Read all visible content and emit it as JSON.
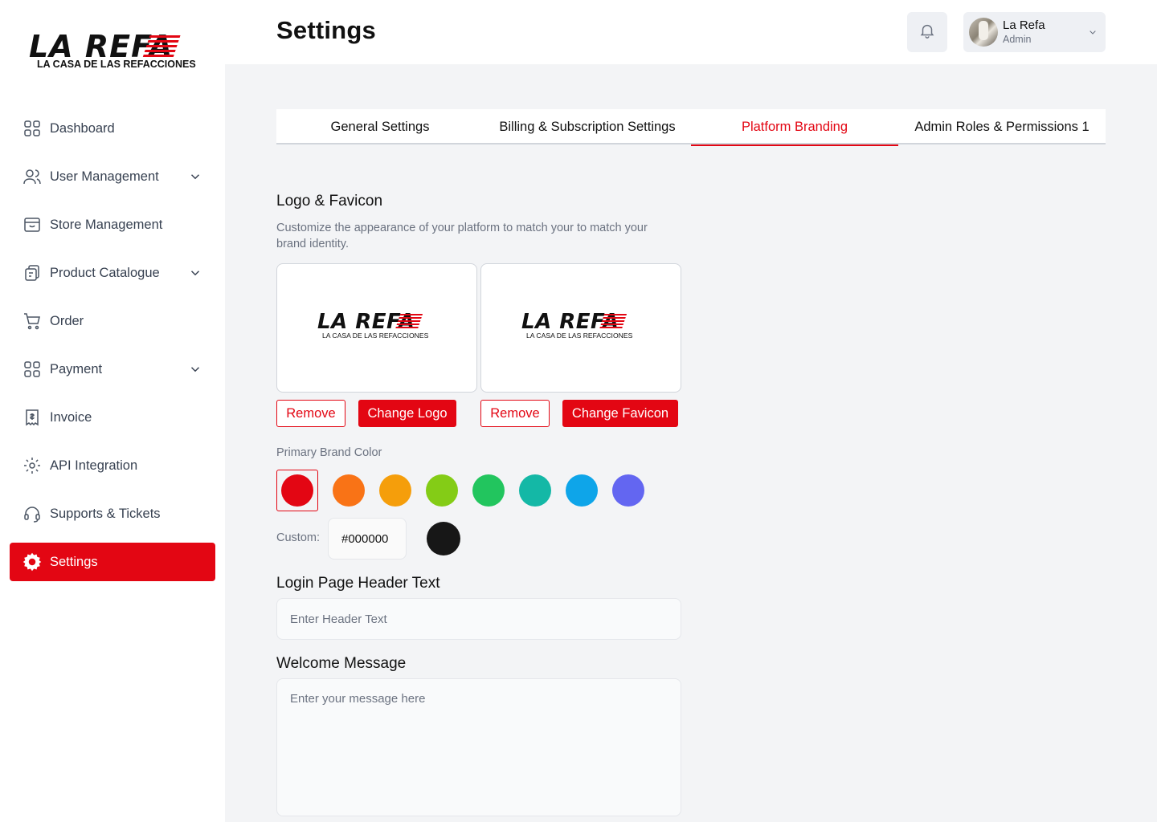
{
  "brand": {
    "word": "LA REFA",
    "tagline": "LA CASA DE LAS REFACCIONES",
    "accent_color": "#e30613"
  },
  "sidebar": {
    "items": [
      {
        "label": "Dashboard",
        "icon": "grid-icon",
        "expandable": false,
        "active": false
      },
      {
        "label": "User Management",
        "icon": "users-icon",
        "expandable": true,
        "active": false
      },
      {
        "label": "Store Management",
        "icon": "store-icon",
        "expandable": false,
        "active": false
      },
      {
        "label": "Product Catalogue",
        "icon": "catalogue-icon",
        "expandable": true,
        "active": false
      },
      {
        "label": "Order",
        "icon": "cart-icon",
        "expandable": false,
        "active": false
      },
      {
        "label": "Payment",
        "icon": "grid-icon",
        "expandable": true,
        "active": false
      },
      {
        "label": "Invoice",
        "icon": "invoice-icon",
        "expandable": false,
        "active": false
      },
      {
        "label": "API Integration",
        "icon": "gear-cog-icon",
        "expandable": false,
        "active": false
      },
      {
        "label": "Supports & Tickets",
        "icon": "headset-icon",
        "expandable": false,
        "active": false
      },
      {
        "label": "Settings",
        "icon": "settings-icon",
        "expandable": false,
        "active": true
      }
    ]
  },
  "header": {
    "title": "Settings",
    "user": {
      "name": "La Refa",
      "role": "Admin"
    }
  },
  "tabs": [
    {
      "label": "General Settings",
      "active": false
    },
    {
      "label": "Billing & Subscription Settings",
      "active": false
    },
    {
      "label": "Platform Branding",
      "active": true
    },
    {
      "label": "Admin Roles & Permissions 1",
      "active": false
    }
  ],
  "branding": {
    "section_title": "Logo & Favicon",
    "section_desc": "Customize the appearance of your platform to match your to match your brand identity.",
    "logo": {
      "remove_label": "Remove",
      "change_label": "Change Logo"
    },
    "favicon": {
      "remove_label": "Remove",
      "change_label": "Change Favicon"
    },
    "primary_color_label": "Primary Brand Color",
    "colors": [
      "#e30613",
      "#f97316",
      "#f59e0b",
      "#84cc16",
      "#22c55e",
      "#14b8a6",
      "#0ea5e9",
      "#6366f1"
    ],
    "selected_color_index": 0,
    "custom_label": "Custom:",
    "custom_value": "#000000",
    "custom_preview_color": "#171717",
    "login_header_label": "Login Page Header Text",
    "login_header_placeholder": "Enter Header Text",
    "welcome_label": "Welcome Message",
    "welcome_placeholder": "Enter your message here"
  }
}
